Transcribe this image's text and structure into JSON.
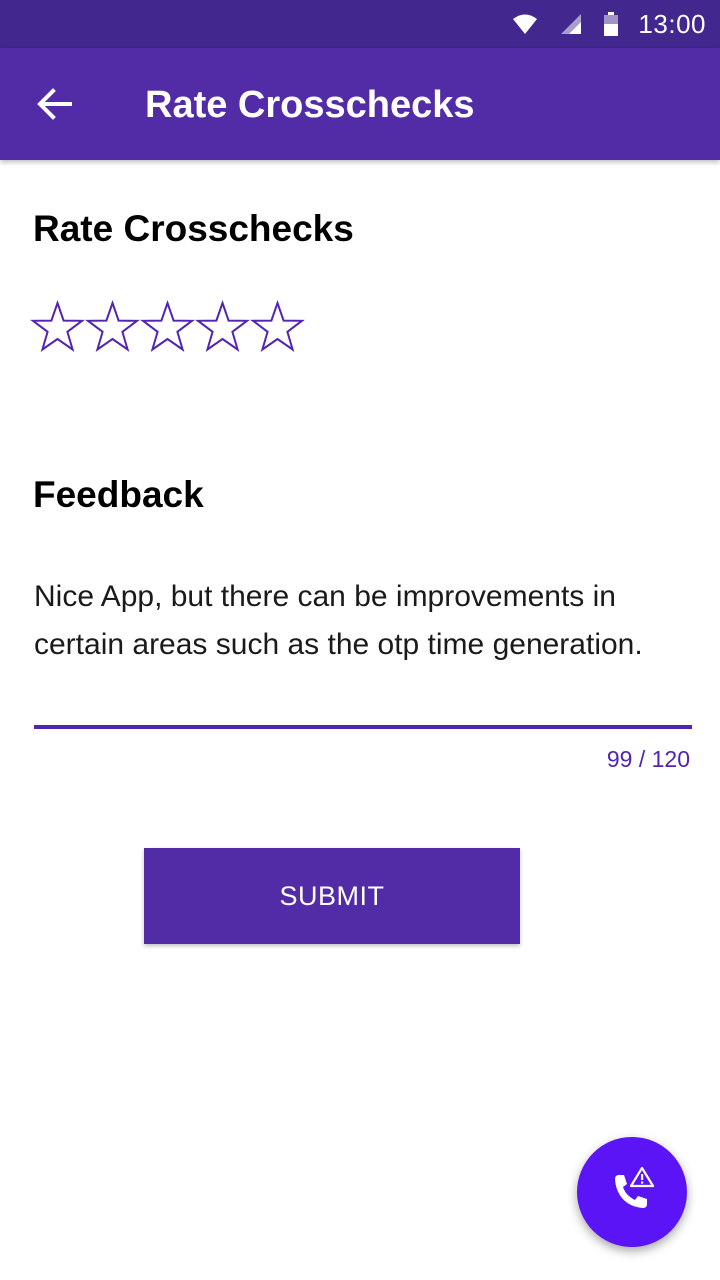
{
  "status_bar": {
    "time": "13:00",
    "icons": [
      "wifi-icon",
      "signal-icon",
      "battery-icon"
    ]
  },
  "app_bar": {
    "back_icon": "arrow-back-icon",
    "title": "Rate Crosschecks"
  },
  "rating": {
    "heading": "Rate Crosschecks",
    "max_stars": 5,
    "selected": 0
  },
  "feedback": {
    "heading": "Feedback",
    "value": "Nice App, but there can be improvements in certain areas such as the otp time generation.",
    "counter": "99 / 120"
  },
  "submit": {
    "label": "SUBMIT"
  },
  "fab": {
    "icon": "phone-alert-icon"
  },
  "colors": {
    "status_bar": "#42278f",
    "app_bar": "#522ca7",
    "accent": "#5125b0",
    "fab": "#5a14f5"
  }
}
